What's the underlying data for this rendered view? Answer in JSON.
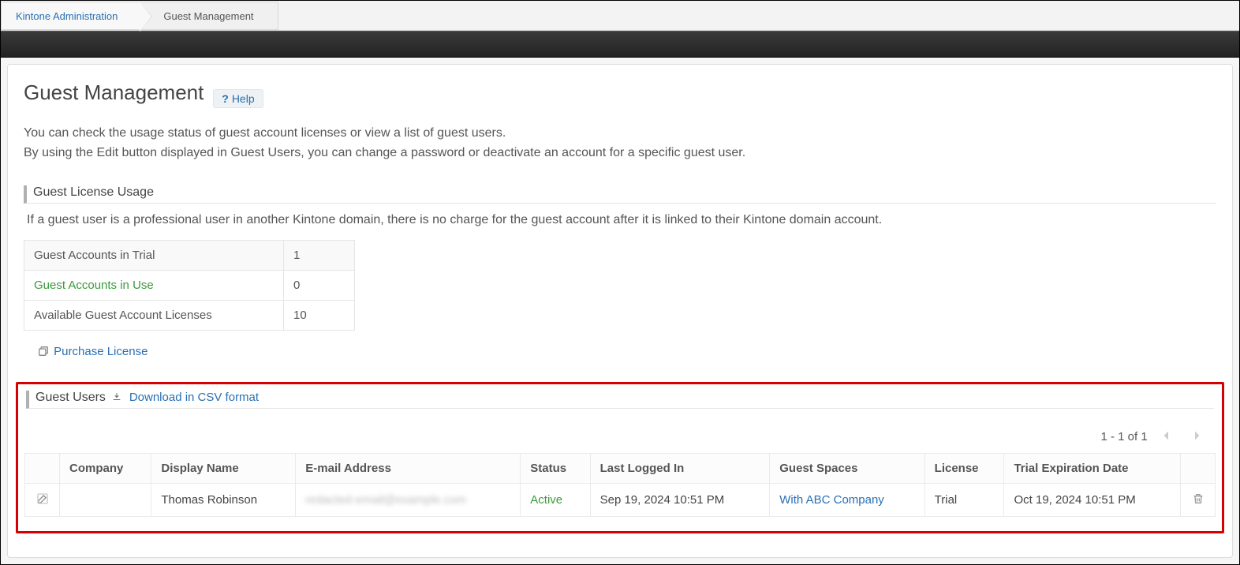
{
  "breadcrumb": {
    "items": [
      {
        "label": "Kintone Administration",
        "link": true
      },
      {
        "label": "Guest Management",
        "link": false
      }
    ]
  },
  "header": {
    "title": "Guest Management",
    "help_label": "Help"
  },
  "lead": {
    "line1": "You can check the usage status of guest account licenses or view a list of guest users.",
    "line2": "By using the Edit button displayed in Guest Users, you can change a password or deactivate an account for a specific guest user."
  },
  "usage_section": {
    "heading": "Guest License Usage",
    "note": "If a guest user is a professional user in another Kintone domain, there is no charge for the guest account after it is linked to their Kintone domain account.",
    "rows": [
      {
        "label": "Guest Accounts in Trial",
        "value": "1"
      },
      {
        "label": "Guest Accounts in Use",
        "value": "0"
      },
      {
        "label": "Available Guest Account Licenses",
        "value": "10"
      }
    ],
    "purchase_label": "Purchase License"
  },
  "users_section": {
    "heading": "Guest Users",
    "download_label": "Download in CSV format",
    "pager_text": "1 - 1 of 1",
    "columns": {
      "company": "Company",
      "display_name": "Display Name",
      "email": "E-mail Address",
      "status": "Status",
      "last_login": "Last Logged In",
      "guest_spaces": "Guest Spaces",
      "license": "License",
      "trial_exp": "Trial Expiration Date"
    },
    "rows": [
      {
        "company": "",
        "display_name": "Thomas Robinson",
        "email": "redacted-email@example.com",
        "status": "Active",
        "last_login": "Sep 19, 2024 10:51 PM",
        "guest_spaces": "With ABC Company",
        "license": "Trial",
        "trial_exp": "Oct 19, 2024 10:51 PM"
      }
    ]
  }
}
